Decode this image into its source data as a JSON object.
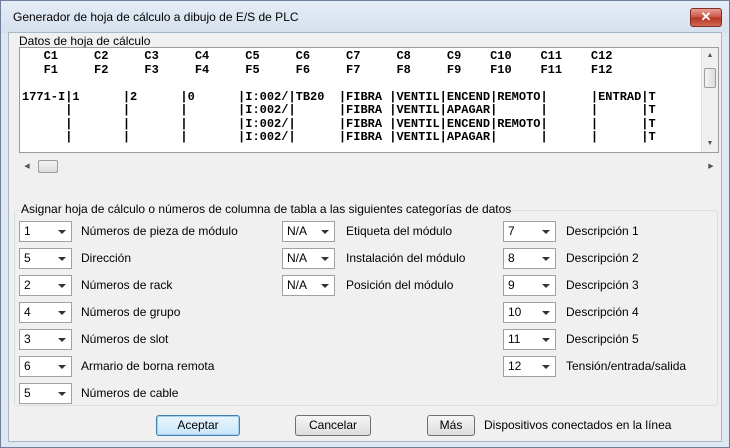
{
  "window": {
    "title": "Generador de hoja de cálculo a dibujo de E/S de PLC",
    "close_glyph": "✕"
  },
  "spreadsheet": {
    "label": "Datos de hoja de cálculo",
    "lines": [
      "   C1     C2     C3     C4     C5     C6     C7     C8     C9    C10    C11    C12",
      "   F1     F2     F3     F4     F5     F6     F7     F8     F9    F10    F11    F12",
      "",
      "1771-I|1      |2      |0      |I:002/|TB20  |FIBRA |VENTIL|ENCEND|REMOTO|      |ENTRAD|T",
      "      |       |       |       |I:002/|      |FIBRA |VENTIL|APAGAR|      |      |      |T",
      "      |       |       |       |I:002/|      |FIBRA |VENTIL|ENCEND|REMOTO|      |      |T",
      "      |       |       |       |I:002/|      |FIBRA |VENTIL|APAGAR|      |      |      |T"
    ]
  },
  "assign": {
    "title": "Asignar hoja de cálculo o números de columna de tabla a las siguientes categorías de datos",
    "col1": [
      {
        "value": "1",
        "label": "Números de pieza de módulo"
      },
      {
        "value": "5",
        "label": "Dirección"
      },
      {
        "value": "2",
        "label": "Números de rack"
      },
      {
        "value": "4",
        "label": "Números de grupo"
      },
      {
        "value": "3",
        "label": "Números de slot"
      },
      {
        "value": "6",
        "label": "Armario de borna remota"
      },
      {
        "value": "5",
        "label": "Números de cable"
      }
    ],
    "col2": [
      {
        "value": "N/A",
        "label": "Etiqueta del módulo"
      },
      {
        "value": "N/A",
        "label": "Instalación del módulo"
      },
      {
        "value": "N/A",
        "label": "Posición del módulo"
      }
    ],
    "col3": [
      {
        "value": "7",
        "label": "Descripción 1"
      },
      {
        "value": "8",
        "label": "Descripción 2"
      },
      {
        "value": "9",
        "label": "Descripción 3"
      },
      {
        "value": "10",
        "label": "Descripción 4"
      },
      {
        "value": "11",
        "label": "Descripción 5"
      },
      {
        "value": "12",
        "label": "Tensión/entrada/salida"
      }
    ]
  },
  "buttons": {
    "accept": "Aceptar",
    "cancel": "Cancelar",
    "more": "Más",
    "more_label": "Dispositivos conectados en la línea"
  }
}
